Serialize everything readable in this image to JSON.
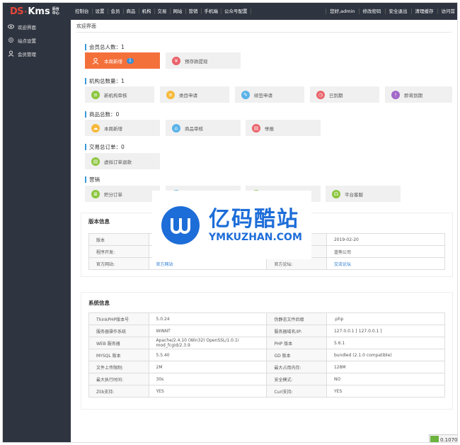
{
  "logo": {
    "ds": "DS",
    "dot": "·",
    "kms": "Kms",
    "sub": "后台中心"
  },
  "topnav": [
    "控制台",
    "设置",
    "会员",
    "商品",
    "机构",
    "交易",
    "网站",
    "营销",
    "手机端",
    "公众号配置"
  ],
  "topright": [
    "您好,admin",
    "修改密码",
    "安全退出",
    "清理缓存",
    "访问首"
  ],
  "sidebar": [
    "欢迎界面",
    "站点设置",
    "会员管理"
  ],
  "breadcrumb": "欢迎界面",
  "sections": {
    "members": {
      "title": "会员总人数：1",
      "cards": [
        {
          "label": "本周新增",
          "badge": "1"
        },
        {
          "label": "预存款提现"
        }
      ]
    },
    "orgs": {
      "title": "机构总数量：1",
      "cards": [
        "新机构审核",
        "类目申请",
        "续签申请",
        "已到期",
        "即将到期"
      ]
    },
    "goods": {
      "title": "商品总数：0",
      "cards": [
        "本周新增",
        "商品审核",
        "举报"
      ]
    },
    "trades": {
      "title": "交易总订单：0",
      "cards": [
        "虚拟订单退款"
      ]
    },
    "market": {
      "title": "营销",
      "cards": [
        "积分订单",
        "",
        "",
        "平台客服"
      ]
    }
  },
  "version": {
    "title": "版本信息",
    "rows": [
      [
        "版本",
        "",
        "",
        "2019-02-20"
      ],
      [
        "程序开发:",
        "",
        "",
        "蓝熊公司"
      ],
      [
        "官方网站:",
        "官方网站",
        "官方论坛:",
        "交流论坛"
      ]
    ]
  },
  "system": {
    "title": "系统信息",
    "rows": [
      [
        "ThinkPHP版本号",
        "5.0.24",
        "伪静态文件后缀",
        ".php"
      ],
      [
        "服务器操作系统",
        "WINNT",
        "服务器域名/IP:",
        "127.0.0.1 [ 127.0.0.1 ]"
      ],
      [
        "WEB 服务器",
        "Apache/2.4.10 (Win32) OpenSSL/1.0.1i mod_fcgid/2.3.9",
        "PHP 版本",
        "5.6.1"
      ],
      [
        "MYSQL 版本",
        "5.5.40",
        "GD 版本",
        "bundled (2.1.0 compatible)"
      ],
      [
        "文件上传限制:",
        "2M",
        "最大占用内存:",
        "128M"
      ],
      [
        "最大执行时间:",
        "30s",
        "安全模式:",
        "NO"
      ],
      [
        "Zlib支持:",
        "YES",
        "Curl支持:",
        "YES"
      ]
    ]
  },
  "watermark": {
    "title": "亿码酷站",
    "url": "YMKUZHAN.COM"
  },
  "timer": "0.10700"
}
